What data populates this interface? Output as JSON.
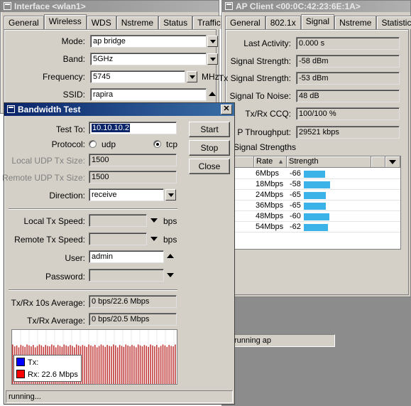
{
  "interface_window": {
    "title": "Interface <wlan1>",
    "tabs": [
      "General",
      "Wireless",
      "WDS",
      "Nstreme",
      "Status",
      "Traffic"
    ],
    "selected_tab": "Wireless",
    "mode_label": "Mode:",
    "mode_value": "ap bridge",
    "band_label": "Band:",
    "band_value": "5GHz",
    "frequency_label": "Frequency:",
    "frequency_value": "5745",
    "frequency_unit": "MHz",
    "ssid_label": "SSID:",
    "ssid_value": "rapira"
  },
  "ap_client_window": {
    "title": "AP Client <00:0C:42:23:6E:1A>",
    "tabs": [
      "General",
      "802.1x",
      "Signal",
      "Nstreme",
      "Statistics"
    ],
    "selected_tab": "Signal",
    "rows": [
      {
        "label": "Last Activity:",
        "value": "0.000 s"
      },
      {
        "label": "Signal Strength:",
        "value": "-58 dBm"
      },
      {
        "label": "Tx Signal Strength:",
        "value": "-53 dBm"
      },
      {
        "label": "Signal To Noise:",
        "value": "48 dB"
      },
      {
        "label": "Tx/Rx CCQ:",
        "value": "100/100 %"
      },
      {
        "label": "P Throughput:",
        "value": "29521 kbps"
      }
    ],
    "strengths_title": "Signal Strengths",
    "table_headers": {
      "rate": "Rate",
      "strength": "Strength"
    },
    "table_rows": [
      {
        "rate": "6Mbps",
        "strength": "-66",
        "level": 0.42
      },
      {
        "rate": "18Mbps",
        "strength": "-58",
        "level": 0.52
      },
      {
        "rate": "24Mbps",
        "strength": "-65",
        "level": 0.43
      },
      {
        "rate": "36Mbps",
        "strength": "-65",
        "level": 0.43
      },
      {
        "rate": "48Mbps",
        "strength": "-60",
        "level": 0.5
      },
      {
        "rate": "54Mbps",
        "strength": "-62",
        "level": 0.47
      }
    ],
    "status": "running ap"
  },
  "bandwidth_window": {
    "title": "Bandwidth Test",
    "test_to_label": "Test To:",
    "test_to_value": "10.10.10.2",
    "protocol_label": "Protocol:",
    "protocol_udp": "udp",
    "protocol_tcp": "tcp",
    "protocol_selected": "tcp",
    "local_udp_label": "Local UDP Tx Size:",
    "local_udp_value": "1500",
    "remote_udp_label": "Remote UDP Tx Size:",
    "remote_udp_value": "1500",
    "direction_label": "Direction:",
    "direction_value": "receive",
    "local_tx_label": "Local Tx Speed:",
    "local_tx_unit": "bps",
    "remote_tx_label": "Remote Tx Speed:",
    "remote_tx_unit": "bps",
    "user_label": "User:",
    "user_value": "admin",
    "password_label": "Password:",
    "password_value": "",
    "avg10_label": "Tx/Rx 10s Average:",
    "avg10_value": "0 bps/22.6 Mbps",
    "avg_label": "Tx/Rx Average:",
    "avg_value": "0 bps/20.5 Mbps",
    "buttons": {
      "start": "Start",
      "stop": "Stop",
      "close": "Close"
    },
    "legend_tx": "Tx:",
    "legend_rx": "Rx:  22.6 Mbps",
    "status": "running...",
    "colors": {
      "tx": "#0000ff",
      "rx": "#ff0000",
      "graph_bar": "#c23a3a"
    },
    "rx_graph": [
      0.86,
      0.82,
      0.84,
      0.8,
      0.85,
      0.83,
      0.81,
      0.86,
      0.84,
      0.82,
      0.85,
      0.8,
      0.83,
      0.86,
      0.84,
      0.81,
      0.85,
      0.83,
      0.82,
      0.86,
      0.84,
      0.8,
      0.85,
      0.83,
      0.81,
      0.86,
      0.84,
      0.82,
      0.85,
      0.83,
      0.8,
      0.86,
      0.84,
      0.82,
      0.85,
      0.83,
      0.81,
      0.86,
      0.84,
      0.82,
      0.85,
      0.8,
      0.83,
      0.86,
      0.84,
      0.81,
      0.85,
      0.83,
      0.82,
      0.86,
      0.84,
      0.8,
      0.85,
      0.83,
      0.81,
      0.86,
      0.84,
      0.82,
      0.85,
      0.83,
      0.8,
      0.86,
      0.84,
      0.82,
      0.85,
      0.83,
      0.81,
      0.86,
      0.84,
      0.82,
      0.85,
      0.8,
      0.83,
      0.86,
      0.84,
      0.81,
      0.85,
      0.83,
      0.82,
      0.86
    ]
  }
}
